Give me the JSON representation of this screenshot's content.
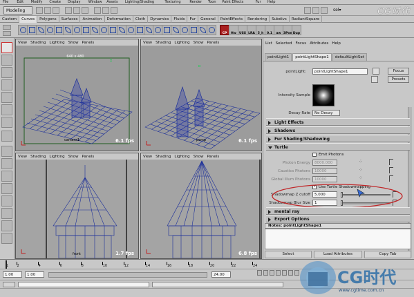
{
  "menubar": {
    "items": [
      "File",
      "Edit",
      "Modify",
      "Create",
      "Display",
      "Window",
      "Assets",
      "Lighting/Shading",
      "Texturing",
      "Render",
      "Toon",
      "Paint Effects",
      "Fur",
      "Help"
    ]
  },
  "status_line": {
    "mode": "Modeling",
    "selection": "sel▾"
  },
  "shelf": {
    "tabs": [
      "Custom",
      "Curves",
      "Polygons",
      "Surfaces",
      "Animation",
      "Deformation",
      "Cloth",
      "Dynamics",
      "Fluids",
      "Fur",
      "General",
      "PaintEffects",
      "Rendering",
      "Subdivs",
      "RadiantSquare"
    ],
    "active_tab": "Curves",
    "labeled_icons": [
      "CP",
      "Hw",
      "USS",
      "LRA",
      "5_h",
      "0.1",
      "aw",
      "3Pom",
      "Dup"
    ]
  },
  "panels": {
    "menu": [
      "View",
      "Shading",
      "Lighting",
      "Show",
      "Panels"
    ],
    "top_left": {
      "camera": "camera1",
      "resolution": "640 x 480",
      "fps": "6.1 fps"
    },
    "top_right": {
      "camera": "persp",
      "fps": "6.1 fps"
    },
    "bottom_left": {
      "camera": "front",
      "fps": "1.7 fps"
    },
    "bottom_right": {
      "camera": "",
      "fps": "6.8 fps"
    }
  },
  "attribute_editor": {
    "menu": [
      "List",
      "Selected",
      "Focus",
      "Attributes",
      "Help"
    ],
    "tabs": [
      "pointLight1",
      "pointLightShape1",
      "defaultLightSet"
    ],
    "active_tab": "pointLightShape1",
    "node_label": "pointLight:",
    "node_name": "pointLightShape1",
    "focus_label": "Focus",
    "presets_label": "Presets",
    "intensity_sample_label": "Intensity Sample",
    "decay_rate_label": "Decay Rate",
    "decay_rate_value": "No Decay",
    "sections": {
      "light_effects": "Light Effects",
      "shadows": "Shadows",
      "fur_shading": "Fur Shading/Shadowing",
      "turtle": "Turtle",
      "mental_ray": "mental ray",
      "export_options": "Export Options"
    },
    "emit_photons_label": "Emit Photons",
    "photon_energy_label": "Photon Energy",
    "photon_energy_value": "8000.000",
    "caustics_photons_label": "Caustics Photons",
    "caustics_photons_value": "10000",
    "global_illum_photons_label": "Global Illum Photons",
    "global_illum_photons_value": "10000",
    "use_turtle_shadowmapping_label": "Use Turtle Shadowmapping",
    "shadowmap_z_cutoff_label": "Shadowmap Z cutoff",
    "shadowmap_z_cutoff_value": "5.000",
    "shadowmap_blur_size_label": "Shadowmap Blur Size",
    "shadowmap_blur_size_value": "1",
    "notes_label": "Notes:  pointLightShape1",
    "footer": {
      "select": "Select",
      "load_attributes": "Load Attributes",
      "copy_tab": "Copy Tab"
    }
  },
  "timeline": {
    "ticks": [
      "1",
      "2",
      "4",
      "6",
      "8",
      "10",
      "12",
      "14",
      "16",
      "18",
      "20",
      "22",
      "24"
    ],
    "start_time": "1.00",
    "range_start": "1.00",
    "range_end": "24.00"
  },
  "branding": {
    "watermark": "CG时代",
    "site": "www.cgtime.com.cn"
  },
  "colors": {
    "accent_red": "#c0282a",
    "wire_blue": "#1c2f9a",
    "camera_green": "#1e5c1e",
    "light_green": "#22cc55"
  }
}
